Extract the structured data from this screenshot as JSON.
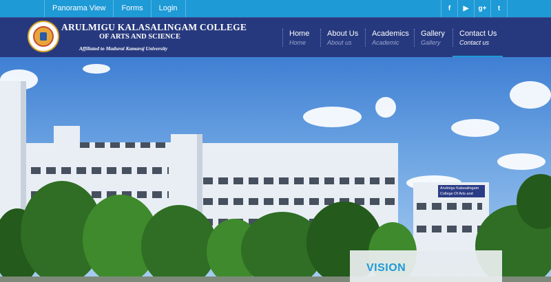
{
  "topbar": {
    "links": [
      "Panorama View",
      "Forms",
      "Login"
    ],
    "social": [
      {
        "icon": "facebook-icon",
        "glyph": "f"
      },
      {
        "icon": "youtube-icon",
        "glyph": "▶"
      },
      {
        "icon": "google-plus-icon",
        "glyph": "g+"
      },
      {
        "icon": "twitter-icon",
        "glyph": "t"
      }
    ]
  },
  "header": {
    "college_line1": "ARULMIGU KALASALINGAM COLLEGE",
    "college_line2": "OF ARTS AND SCIENCE",
    "affiliation": "Affiliated to Madurai Kamaraj University"
  },
  "nav": [
    {
      "label": "Home",
      "sub": "Home"
    },
    {
      "label": "About Us",
      "sub": "About us"
    },
    {
      "label": "Academics",
      "sub": "Academic"
    },
    {
      "label": "Gallery",
      "sub": "Gallery"
    },
    {
      "label": "Contact Us",
      "sub": "Contact us",
      "active": true
    }
  ],
  "hero": {
    "building_sign": "Arulmigu Kalasalingam College Of Arts and Science",
    "vision_title": "VISION"
  },
  "colors": {
    "topbar": "#1e9ad6",
    "header": "#27397e",
    "accent": "#1e9ad6"
  }
}
